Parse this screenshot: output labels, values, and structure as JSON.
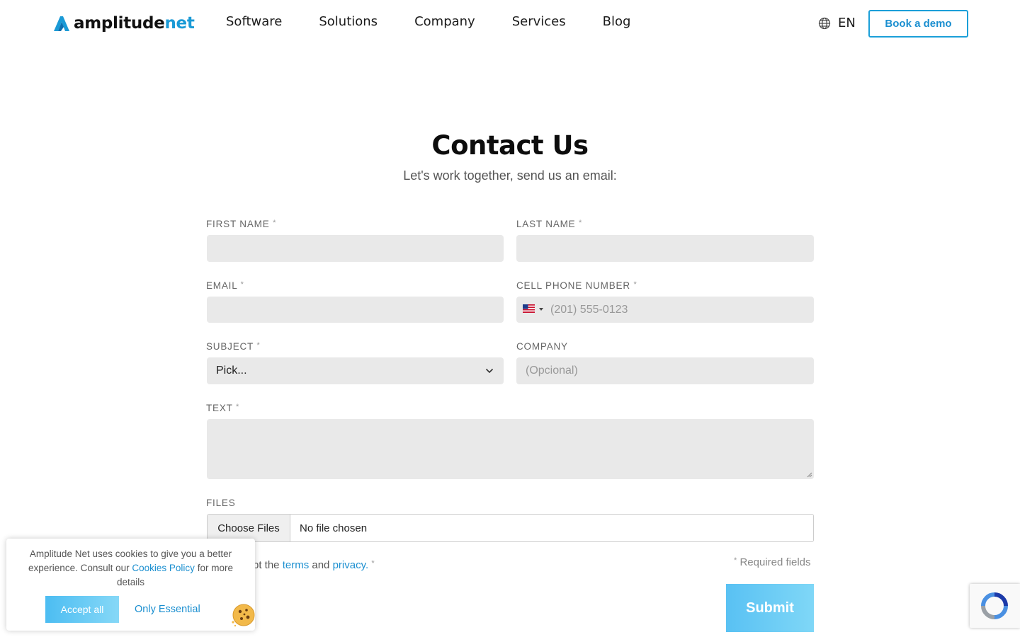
{
  "header": {
    "logo": {
      "main": "amplitude",
      "accent": "net"
    },
    "nav": [
      "Software",
      "Solutions",
      "Company",
      "Services",
      "Blog"
    ],
    "language": "EN",
    "demo_label": "Book a demo"
  },
  "page": {
    "title": "Contact Us",
    "subtitle": "Let's work together, send us an email:"
  },
  "form": {
    "required_mark": "*",
    "first_name_label": "FIRST NAME",
    "last_name_label": "LAST NAME",
    "email_label": "EMAIL",
    "phone_label": "CELL PHONE NUMBER",
    "phone_placeholder": "(201) 555-0123",
    "subject_label": "SUBJECT",
    "subject_value": "Pick...",
    "company_label": "COMPANY",
    "company_placeholder": "(Opcional)",
    "text_label": "TEXT",
    "files_label": "FILES",
    "choose_files": "Choose Files",
    "no_file": "No file chosen",
    "accept_prefix": "pt the",
    "terms_link": "terms",
    "and_word": "and",
    "privacy_link": "privacy.",
    "required_note": "Required fields",
    "submit_label": "Submit"
  },
  "cookie": {
    "text_before": "Amplitude Net uses cookies to give you a better experience. Consult our",
    "policy_link": "Cookies Policy",
    "text_after": "for more details",
    "accept_label": "Accept all",
    "essential_label": "Only Essential"
  },
  "icons": {
    "globe": "globe-icon",
    "chevron": "chevron-down-icon",
    "flag": "us-flag-icon",
    "cookie": "cookie-icon",
    "recaptcha": "recaptcha-icon"
  },
  "colors": {
    "accent": "#1b8fd0",
    "field_bg": "#e9e9e9",
    "submit_gradient_start": "#59c1f3",
    "submit_gradient_end": "#7fd7f7"
  }
}
